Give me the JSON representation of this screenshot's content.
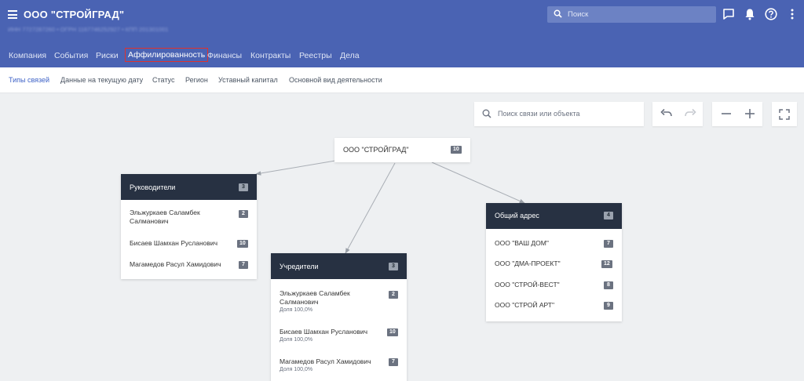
{
  "header": {
    "title": "ООО \"СТРОЙГРАД\"",
    "registration": "ИНН 7727287260 • ОГРН 1167746252927 • КПП 201301001",
    "search_placeholder": "Поиск",
    "icons": [
      "menu-icon",
      "search-icon",
      "message-icon",
      "bell-icon",
      "help-icon",
      "more-vertical-icon"
    ],
    "colors": {
      "primary": "#4a63b3",
      "active_tab_border": "#e0312d"
    }
  },
  "tabs": [
    {
      "label": "Компания"
    },
    {
      "label": "События"
    },
    {
      "label": "Риски"
    },
    {
      "label": "Аффилированность",
      "active": true
    },
    {
      "label": "Финансы"
    },
    {
      "label": "Контракты"
    },
    {
      "label": "Реестры"
    },
    {
      "label": "Дела"
    }
  ],
  "subnav": [
    {
      "label": "Типы связей",
      "active": true
    },
    {
      "label": "Данные на текущую дату"
    },
    {
      "label": "Статус"
    },
    {
      "label": "Регион"
    },
    {
      "label": "Уставный капитал"
    },
    {
      "label": "Основной вид деятельности"
    }
  ],
  "graph": {
    "search_placeholder": "Поиск связи или объекта",
    "controls": [
      "undo-icon",
      "redo-icon",
      "zoom-out-icon",
      "zoom-in-icon",
      "fullscreen-icon"
    ],
    "root": {
      "label": "ООО \"СТРОЙГРАД\"",
      "count": "10"
    },
    "groups": {
      "managers": {
        "title": "Руководители",
        "count": "3",
        "items": [
          {
            "name": "Эльжуркаев Саламбек Салманович",
            "count": "2"
          },
          {
            "name": "Бисаев Шамхан Русланович",
            "count": "10"
          },
          {
            "name": "Магамедов Расул Хамидович",
            "count": "7"
          }
        ]
      },
      "founders": {
        "title": "Учредители",
        "count": "3",
        "items": [
          {
            "name": "Эльжуркаев Саламбек Салманович",
            "share": "Доля 100,0%",
            "count": "2"
          },
          {
            "name": "Бисаев Шамхан Русланович",
            "share": "Доля 100,0%",
            "count": "10"
          },
          {
            "name": "Магамедов Расул Хамидович",
            "share": "Доля 100,0%",
            "count": "7"
          }
        ]
      },
      "address": {
        "title": "Общий адрес",
        "count": "4",
        "items": [
          {
            "name": "ООО \"ВАШ ДОМ\"",
            "count": "7"
          },
          {
            "name": "ООО \"ДМА-ПРОЕКТ\"",
            "count": "12"
          },
          {
            "name": "ООО \"СТРОЙ-ВЕСТ\"",
            "count": "8"
          },
          {
            "name": "ООО \"СТРОЙ АРТ\"",
            "count": "9"
          }
        ]
      }
    }
  }
}
